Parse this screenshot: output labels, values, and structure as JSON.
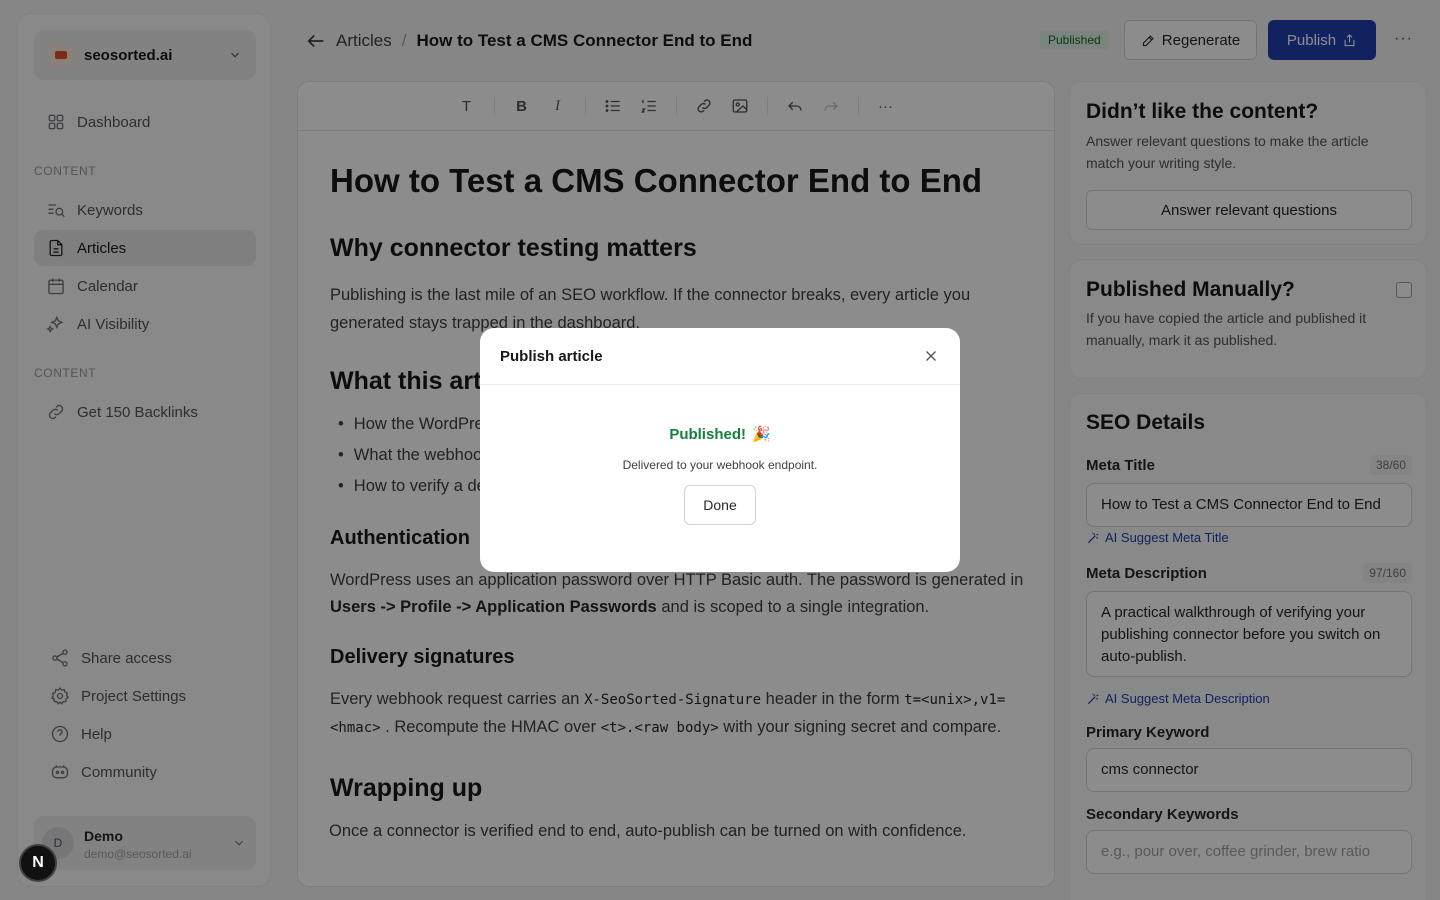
{
  "sidebar": {
    "org_name": "seosorted.ai",
    "nav": [
      {
        "label": "Dashboard",
        "icon": "grid-icon"
      },
      {
        "label": "Keywords",
        "icon": "keyword-search-icon"
      },
      {
        "label": "Articles",
        "icon": "document-icon",
        "active": true
      },
      {
        "label": "Calendar",
        "icon": "calendar-icon"
      },
      {
        "label": "AI Visibility",
        "icon": "sparkle-icon"
      },
      {
        "label": "Get 150 Backlinks",
        "icon": "link-icon"
      }
    ],
    "section_labels": [
      "CONTENT",
      "CONTENT"
    ],
    "footer": [
      {
        "label": "Share access",
        "icon": "share-icon"
      },
      {
        "label": "Project Settings",
        "icon": "gear-icon"
      },
      {
        "label": "Help",
        "icon": "help-icon"
      },
      {
        "label": "Community",
        "icon": "discord-icon"
      }
    ],
    "user": {
      "initial": "D",
      "name": "Demo",
      "email": "demo@seosorted.ai"
    },
    "n_badge": "N"
  },
  "header": {
    "breadcrumb_root": "Articles",
    "breadcrumb_sep": "/",
    "breadcrumb_current": "How to Test a CMS Connector End to End",
    "status": "Published",
    "regenerate_label": "Regenerate",
    "publish_label": "Publish",
    "more_label": "···"
  },
  "article": {
    "title": "How to Test a CMS Connector End to End",
    "h_why": "Why connector testing matters",
    "p_why": "Publishing is the last mile of an SEO workflow. If the connector breaks, every article you generated stays trapped in the dashboard.",
    "h_what": "What this article covers",
    "bullets": [
      "How the WordPress connector authenticates",
      "What the webhook signature looks like",
      "How to verify a delivery end to end"
    ],
    "h_auth": "Authentication",
    "p_auth_1": "WordPress uses an application password over HTTP Basic auth. The password is generated in",
    "p_auth_bold": "Users -> Profile -> Application Passwords",
    "p_auth_2": "and is scoped to a single integration.",
    "h_sig": "Delivery signatures",
    "p_sig_1": "Every webhook request carries an",
    "p_sig_code1": "X-SeoSorted-Signature",
    "p_sig_2": "header in the form",
    "p_sig_code2": "t=<unix>,v1=<hmac>",
    "p_sig_3": ". Recompute the HMAC over",
    "p_sig_code3": "<t>.<raw body>",
    "p_sig_4": "with your signing secret and compare.",
    "h_wrap": "Wrapping up",
    "p_wrap": "Once a connector is verified end to end, auto-publish can be turned on with confidence."
  },
  "panel": {
    "feedback_title": "Didn’t like the content?",
    "feedback_text": "Answer relevant questions to make the article match your writing style.",
    "feedback_button": "Answer relevant questions",
    "manual_title": "Published Manually?",
    "manual_text": "If you have copied the article and published it manually, mark it as published.",
    "seo_title": "SEO Details",
    "meta_title_label": "Meta Title",
    "meta_title_count": "38/60",
    "meta_title_value": "How to Test a CMS Connector End to End",
    "ai_meta_title": "AI Suggest Meta Title",
    "meta_desc_label": "Meta Description",
    "meta_desc_count": "97/160",
    "meta_desc_value": "A practical walkthrough of verifying your publishing connector before you switch on auto-publish.",
    "ai_meta_desc": "AI Suggest Meta Description",
    "primary_kw_label": "Primary Keyword",
    "primary_kw_value": "cms connector",
    "secondary_kw_label": "Secondary Keywords",
    "secondary_kw_placeholder": "e.g., pour over, coffee grinder, brew ratio"
  },
  "modal": {
    "title": "Publish article",
    "success": "Published!",
    "emoji": "🎉",
    "subtitle": "Delivered to your webhook endpoint.",
    "done_label": "Done"
  },
  "colors": {
    "primary": "#1e40af",
    "success": "#15803d",
    "status_bg": "#ddf3e3"
  }
}
